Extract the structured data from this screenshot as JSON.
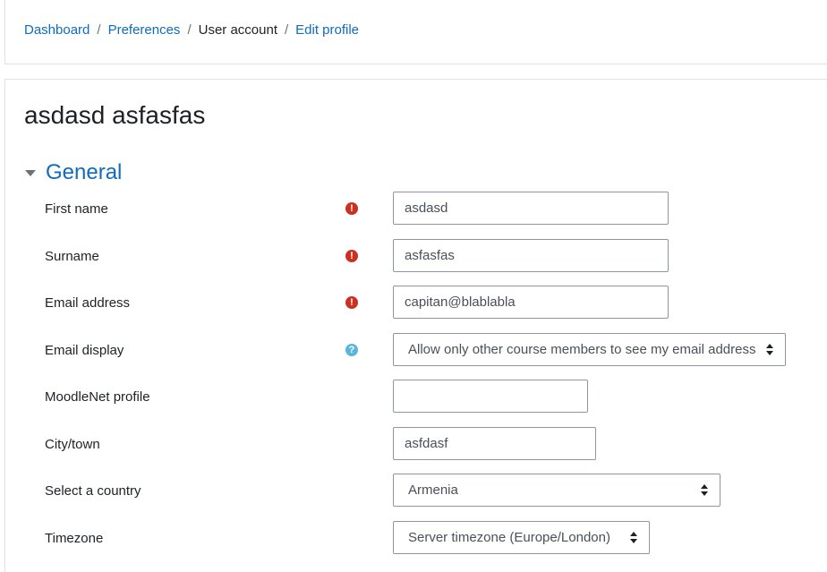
{
  "breadcrumb": {
    "items": [
      "Dashboard",
      "Preferences",
      "User account",
      "Edit profile"
    ],
    "separator": "/"
  },
  "page": {
    "title": "asdasd asfasfas"
  },
  "section": {
    "title": "General",
    "expanded": true
  },
  "form": {
    "first_name": {
      "label": "First name",
      "value": "asdasd",
      "required": true
    },
    "surname": {
      "label": "Surname",
      "value": "asfasfas",
      "required": true
    },
    "email": {
      "label": "Email address",
      "value": "capitan@blablabla",
      "required": true
    },
    "email_display": {
      "label": "Email display",
      "selected": "Allow only other course members to see my email address",
      "help": true
    },
    "moodlenet": {
      "label": "MoodleNet profile",
      "value": ""
    },
    "city": {
      "label": "City/town",
      "value": "asfdasf"
    },
    "country": {
      "label": "Select a country",
      "selected": "Armenia"
    },
    "timezone": {
      "label": "Timezone",
      "selected": "Server timezone (Europe/London)"
    }
  },
  "icons": {
    "required": "exclamation-circle-icon",
    "help": "question-circle-icon"
  },
  "colors": {
    "link": "#0f6cbf",
    "required": "#ca3120",
    "help": "#5bb6d9",
    "text": "#1d2125"
  }
}
